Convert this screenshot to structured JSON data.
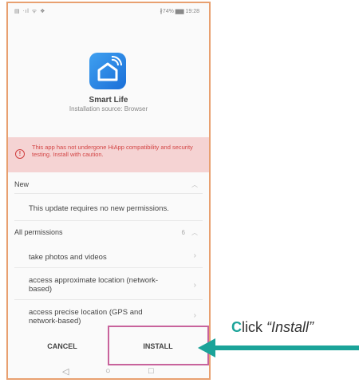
{
  "status_bar": {
    "left": "▤ ᐧıl ᯤ ❖",
    "right": "∦74% ▆▆ 19:28"
  },
  "app": {
    "name": "Smart Life",
    "source": "Installation source: Browser"
  },
  "warning": {
    "text": "This app has not undergone HiApp compatibility and security testing. Install with caution."
  },
  "new_section": {
    "label": "New",
    "message": "This update requires no new permissions."
  },
  "permissions": {
    "label": "All permissions",
    "count": "6",
    "items": [
      {
        "label": "take photos and videos"
      },
      {
        "label": "access approximate location (network-based)"
      },
      {
        "label": "access precise location (GPS and network-based)"
      }
    ]
  },
  "buttons": {
    "cancel": "CANCEL",
    "install": "INSTALL"
  },
  "annotation": {
    "first_letter": "C",
    "rest": "lick ",
    "quoted": "“Install”"
  },
  "colors": {
    "accent": "#1ba399",
    "highlight": "#c8639c",
    "warning_bg": "#f5d3d3",
    "warning_text": "#d34545",
    "phone_border": "#e8a070"
  },
  "icons": [
    "signal-icon",
    "wifi-icon",
    "battery-icon",
    "smart-life-app-icon",
    "warning-icon",
    "chevron-up-icon",
    "chevron-right-icon",
    "back-icon",
    "home-icon",
    "recents-icon",
    "arrow-icon"
  ]
}
